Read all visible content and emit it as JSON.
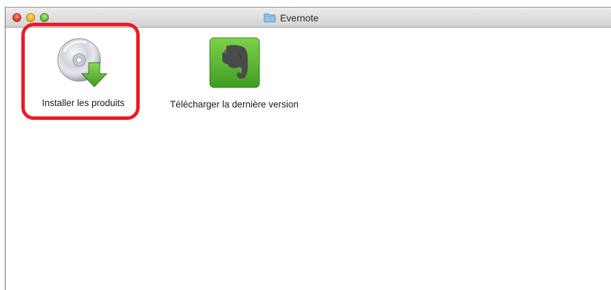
{
  "window": {
    "title": "Evernote",
    "title_icon": "folder-icon"
  },
  "items": [
    {
      "label": "Installer les produits",
      "icon": "cd-install-icon",
      "highlighted": true
    },
    {
      "label": "Télécharger la dernière version",
      "icon": "evernote-app-icon",
      "highlighted": false
    }
  ],
  "colors": {
    "highlight": "#ec1a24",
    "evernote_green": "#5cb32e"
  }
}
